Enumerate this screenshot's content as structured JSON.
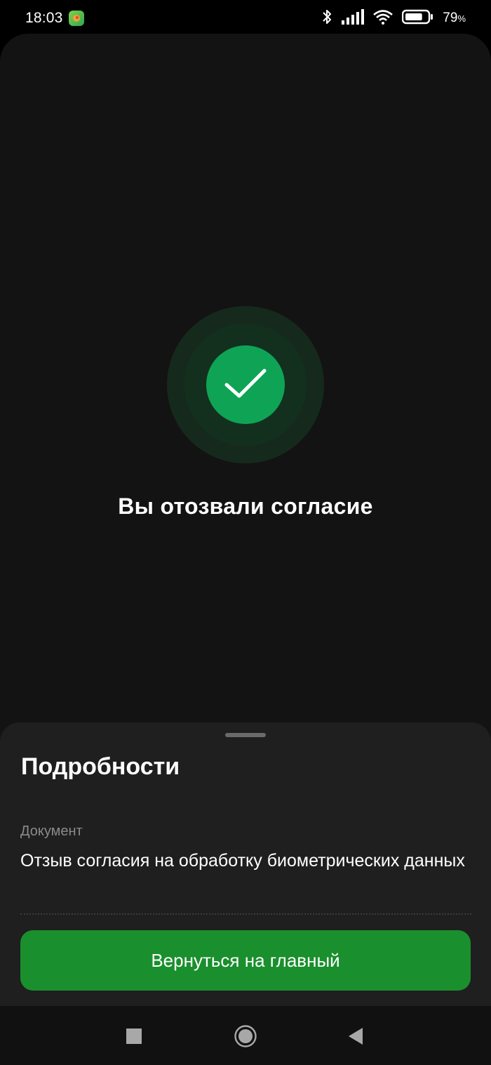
{
  "status_bar": {
    "time": "18:03",
    "battery_percent": "79",
    "battery_unit": "%",
    "battery_level": 0.79,
    "icons": [
      "app-notification-icon",
      "bluetooth-icon",
      "signal-icon",
      "wifi-icon",
      "battery-icon"
    ]
  },
  "result": {
    "icon": "checkmark-icon",
    "title": "Вы отозвали согласие",
    "accent_color": "#0fa356"
  },
  "details_sheet": {
    "title": "Подробности",
    "document_label": "Документ",
    "document_value": "Отзыв согласия на обработку биометрических данных",
    "primary_button_label": "Вернуться на главный",
    "button_color": "#1a8f2d"
  },
  "nav_bar": {
    "buttons": [
      "recents-square-icon",
      "home-circle-icon",
      "back-triangle-icon"
    ]
  }
}
